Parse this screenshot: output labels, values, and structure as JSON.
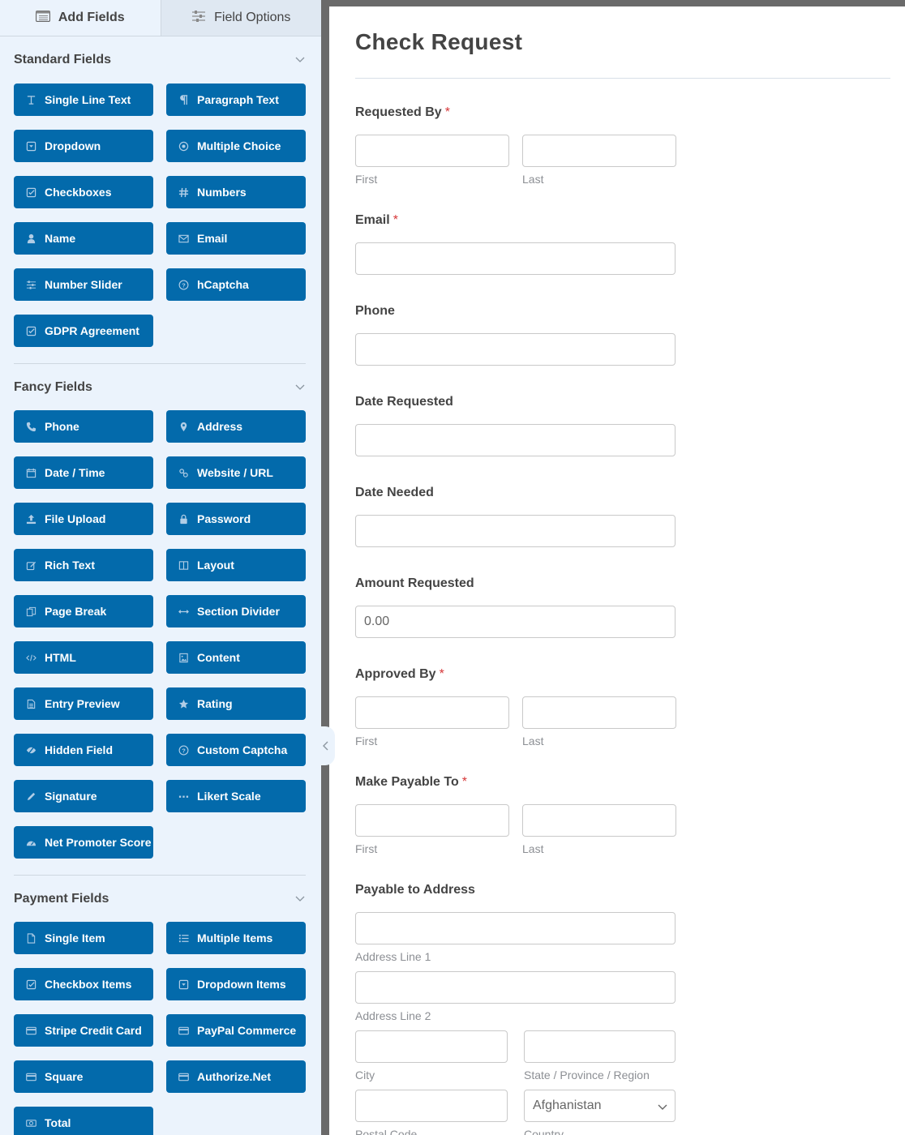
{
  "sidebar": {
    "tabs": [
      {
        "label": "Add Fields",
        "icon": "list-icon",
        "active": true
      },
      {
        "label": "Field Options",
        "icon": "sliders-icon",
        "active": false
      }
    ],
    "sections": [
      {
        "title": "Standard Fields",
        "fields": [
          {
            "label": "Single Line Text",
            "icon": "text-icon"
          },
          {
            "label": "Paragraph Text",
            "icon": "paragraph-icon"
          },
          {
            "label": "Dropdown",
            "icon": "dropdown-icon"
          },
          {
            "label": "Multiple Choice",
            "icon": "radio-icon"
          },
          {
            "label": "Checkboxes",
            "icon": "checkbox-icon"
          },
          {
            "label": "Numbers",
            "icon": "hash-icon"
          },
          {
            "label": "Name",
            "icon": "user-icon"
          },
          {
            "label": "Email",
            "icon": "envelope-icon"
          },
          {
            "label": "Number Slider",
            "icon": "sliders-icon"
          },
          {
            "label": "hCaptcha",
            "icon": "question-circle-icon"
          },
          {
            "label": "GDPR Agreement",
            "icon": "checkbox-icon"
          }
        ]
      },
      {
        "title": "Fancy Fields",
        "fields": [
          {
            "label": "Phone",
            "icon": "phone-icon"
          },
          {
            "label": "Address",
            "icon": "map-marker-icon"
          },
          {
            "label": "Date / Time",
            "icon": "calendar-icon"
          },
          {
            "label": "Website / URL",
            "icon": "link-icon"
          },
          {
            "label": "File Upload",
            "icon": "upload-icon"
          },
          {
            "label": "Password",
            "icon": "lock-icon"
          },
          {
            "label": "Rich Text",
            "icon": "edit-icon"
          },
          {
            "label": "Layout",
            "icon": "columns-icon"
          },
          {
            "label": "Page Break",
            "icon": "copy-icon"
          },
          {
            "label": "Section Divider",
            "icon": "arrows-h-icon"
          },
          {
            "label": "HTML",
            "icon": "code-icon"
          },
          {
            "label": "Content",
            "icon": "image-file-icon"
          },
          {
            "label": "Entry Preview",
            "icon": "file-text-icon"
          },
          {
            "label": "Rating",
            "icon": "star-icon"
          },
          {
            "label": "Hidden Field",
            "icon": "eye-slash-icon"
          },
          {
            "label": "Custom Captcha",
            "icon": "question-circle-icon"
          },
          {
            "label": "Signature",
            "icon": "pencil-icon"
          },
          {
            "label": "Likert Scale",
            "icon": "ellipsis-icon"
          },
          {
            "label": "Net Promoter Score",
            "icon": "gauge-icon"
          }
        ]
      },
      {
        "title": "Payment Fields",
        "fields": [
          {
            "label": "Single Item",
            "icon": "file-icon"
          },
          {
            "label": "Multiple Items",
            "icon": "list-ul-icon"
          },
          {
            "label": "Checkbox Items",
            "icon": "checkbox-icon"
          },
          {
            "label": "Dropdown Items",
            "icon": "dropdown-icon"
          },
          {
            "label": "Stripe Credit Card",
            "icon": "credit-card-icon"
          },
          {
            "label": "PayPal Commerce",
            "icon": "credit-card-icon"
          },
          {
            "label": "Square",
            "icon": "credit-card-icon"
          },
          {
            "label": "Authorize.Net",
            "icon": "credit-card-icon"
          },
          {
            "label": "Total",
            "icon": "money-icon"
          }
        ]
      }
    ]
  },
  "form": {
    "title": "Check Request",
    "fields": {
      "requested_by": {
        "label": "Requested By",
        "required": "*",
        "first": "First",
        "last": "Last"
      },
      "email": {
        "label": "Email",
        "required": "*"
      },
      "phone": {
        "label": "Phone"
      },
      "date_requested": {
        "label": "Date Requested"
      },
      "date_needed": {
        "label": "Date Needed"
      },
      "amount_requested": {
        "label": "Amount Requested",
        "value": "0.00"
      },
      "approved_by": {
        "label": "Approved By",
        "required": "*",
        "first": "First",
        "last": "Last"
      },
      "make_payable_to": {
        "label": "Make Payable To",
        "required": "*",
        "first": "First",
        "last": "Last"
      },
      "payable_address": {
        "label": "Payable to Address",
        "line1": "Address Line 1",
        "line2": "Address Line 2",
        "city": "City",
        "state": "State / Province / Region",
        "postal": "Postal Code",
        "country": "Country",
        "country_value": "Afghanistan"
      }
    }
  },
  "colors": {
    "button_bg": "#036aab",
    "required": "#d63638",
    "sidebar_bg": "#ebf3fc"
  }
}
